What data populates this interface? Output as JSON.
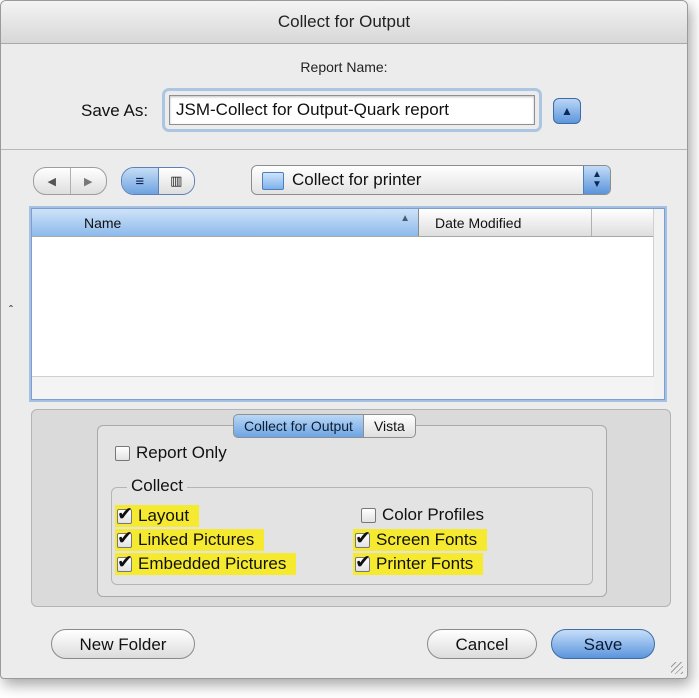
{
  "window": {
    "title": "Collect for Output"
  },
  "save_panel": {
    "report_name_label": "Report Name:",
    "save_as_label": "Save As:",
    "save_as_value": "JSM-Collect for Output-Quark report"
  },
  "toolbar": {
    "back_glyph": "◀",
    "forward_glyph": "▶",
    "list_view_glyph": "≡",
    "column_view_glyph": "▥",
    "location": "Collect for printer"
  },
  "file_list": {
    "columns": [
      "Name",
      "Date Modified"
    ],
    "sort_glyph": "▲",
    "rows": []
  },
  "options": {
    "tabs": [
      "Collect for Output",
      "Vista"
    ],
    "active_tab": "Collect for Output",
    "report_only": {
      "label": "Report Only",
      "checked": false
    },
    "collect_group_label": "Collect",
    "items": [
      {
        "label": "Layout",
        "checked": true
      },
      {
        "label": "Linked Pictures",
        "checked": true
      },
      {
        "label": "Embedded Pictures",
        "checked": true
      },
      {
        "label": "Color Profiles",
        "checked": false
      },
      {
        "label": "Screen Fonts",
        "checked": true
      },
      {
        "label": "Printer Fonts",
        "checked": true
      }
    ]
  },
  "buttons": {
    "new_folder": "New Folder",
    "cancel": "Cancel",
    "save": "Save"
  },
  "colors": {
    "accent": "#5b95dd",
    "highlight": "#f5ea2f",
    "window_bg": "#ececec"
  }
}
